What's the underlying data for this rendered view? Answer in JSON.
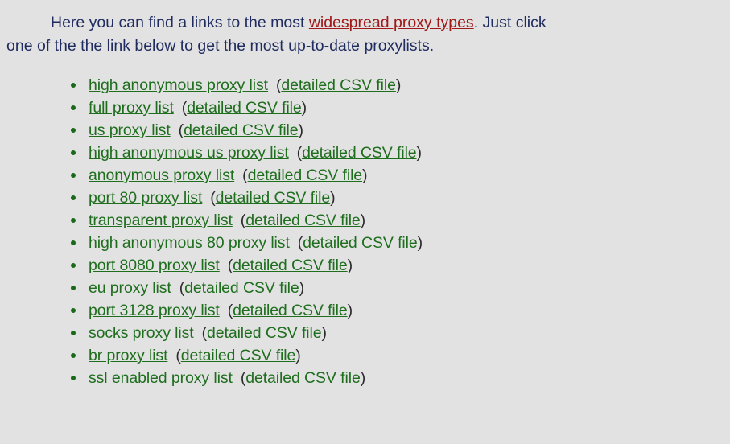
{
  "intro": {
    "before_link": "Here you can find a links to the most ",
    "link_text": "widespread proxy types",
    "after_link": ". Just click",
    "line2": "one of the the link below to get the most up-to-date proxylists."
  },
  "csv_label": "detailed CSV file",
  "items": [
    {
      "label": "high  anonymous proxy list"
    },
    {
      "label": "full proxy list"
    },
    {
      "label": "us proxy list"
    },
    {
      "label": "high  anonymous  us proxy list"
    },
    {
      "label": "anonymous proxy list"
    },
    {
      "label": "port  80 proxy list"
    },
    {
      "label": "transparent proxy list"
    },
    {
      "label": "high  anonymous  80 proxy list"
    },
    {
      "label": "port  8080 proxy list"
    },
    {
      "label": "eu proxy list"
    },
    {
      "label": "port  3128 proxy list"
    },
    {
      "label": "socks proxy list"
    },
    {
      "label": "br proxy list"
    },
    {
      "label": "ssl  enabled proxy list"
    }
  ]
}
